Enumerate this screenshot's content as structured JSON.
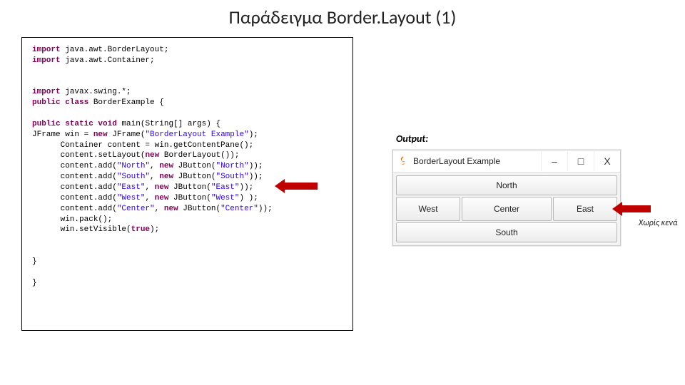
{
  "title": "Παράδειγμα Border.Layout (1)",
  "output_label": "Output:",
  "annotation": "Χωρίς κενά",
  "window": {
    "title": "BorderLayout Example",
    "min": "–",
    "max": "□",
    "close": "X",
    "buttons": {
      "north": "North",
      "south": "South",
      "east": "East",
      "west": "West",
      "center": "Center"
    }
  },
  "code": {
    "l1a": "import",
    "l1b": " java.awt.BorderLayout;",
    "l2a": "import",
    "l2b": " java.awt.Container;",
    "l3a": "import",
    "l3b": " javax.swing.*;",
    "l4a": "public",
    "l4b": " class",
    "l4c": " BorderExample {",
    "l5a": "public",
    "l5b": " static",
    "l5c": " void",
    "l5d": " main(String[] args) {",
    "l6a": "JFrame win = ",
    "l6b": "new",
    "l6c": " JFrame(",
    "l6d": "\"BorderLayout Example\"",
    "l6e": ");",
    "l7": "      Container content = win.getContentPane();",
    "l8a": "      content.setLayout(",
    "l8b": "new",
    "l8c": " BorderLayout());",
    "l9a": "      content.add(",
    "l9b": "\"North\"",
    "l9c": ", ",
    "l9d": "new",
    "l9e": " JButton(",
    "l9f": "\"North\"",
    "l9g": "));",
    "l10a": "      content.add(",
    "l10b": "\"South\"",
    "l10c": ", ",
    "l10d": "new",
    "l10e": " JButton(",
    "l10f": "\"South\"",
    "l10g": "));",
    "l11a": "      content.add(",
    "l11b": "\"East\"",
    "l11c": ", ",
    "l11d": "new",
    "l11e": " JButton(",
    "l11f": "\"East\"",
    "l11g": "));",
    "l12a": "      content.add(",
    "l12b": "\"West\"",
    "l12c": ", ",
    "l12d": "new",
    "l12e": " JButton(",
    "l12f": "\"West\"",
    "l12g": ") );",
    "l13a": "      content.add(",
    "l13b": "\"Center\"",
    "l13c": ", ",
    "l13d": "new",
    "l13e": " JButton(",
    "l13f": "\"Center\"",
    "l13g": "));",
    "l14": "      win.pack();",
    "l15a": "      win.setVisible(",
    "l15b": "true",
    "l15c": ");",
    "l16": "}",
    "l17": "}"
  }
}
